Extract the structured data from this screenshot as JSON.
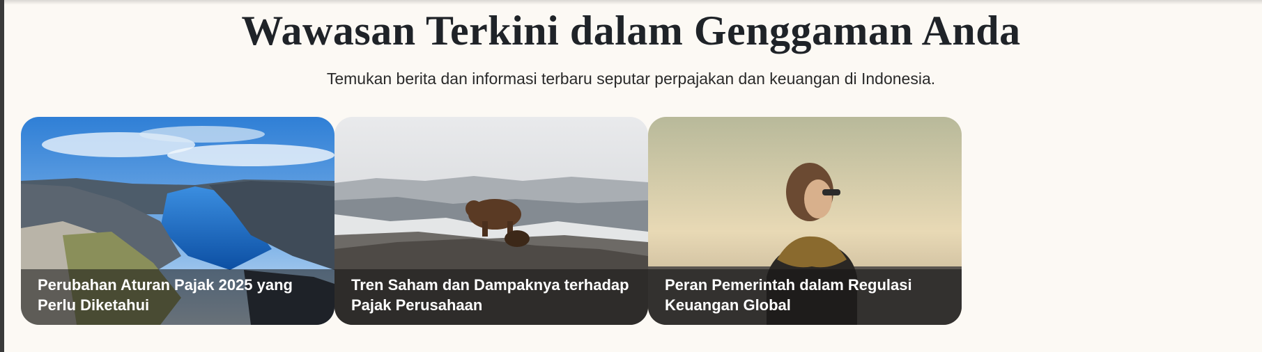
{
  "section": {
    "title": "Wawasan Terkini dalam Genggaman Anda",
    "subtitle": "Temukan berita dan informasi terbaru seputar perpajakan dan keuangan di Indonesia."
  },
  "cards": [
    {
      "title": "Perubahan Aturan Pajak 2025 yang Perlu Diketahui",
      "image": "fjord-landscape-photo"
    },
    {
      "title": "Tren Saham dan Dampaknya terhadap Pajak Perusahaan",
      "image": "bear-on-rocks-photo"
    },
    {
      "title": "Peran Pemerintah dalam Regulasi Keuangan Global",
      "image": "man-with-scarf-photo"
    }
  ]
}
